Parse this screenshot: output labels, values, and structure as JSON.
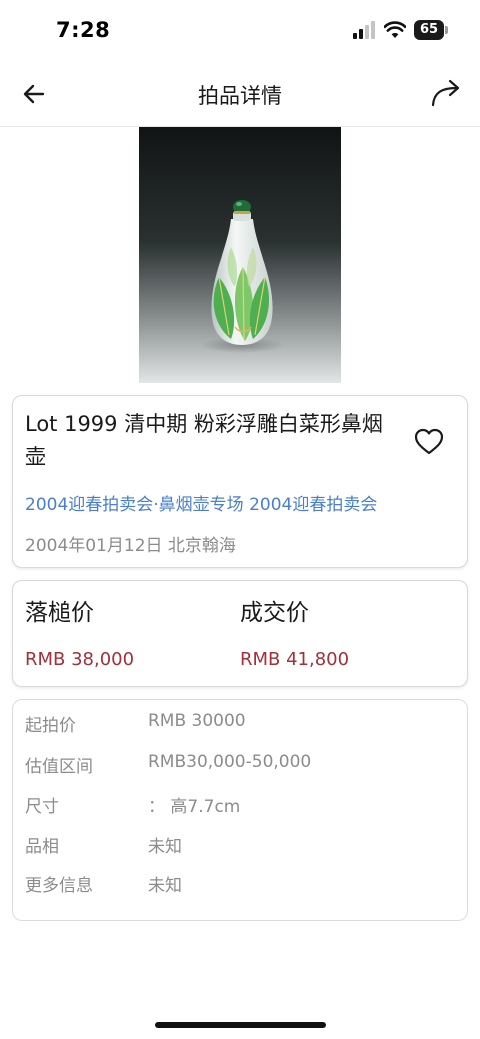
{
  "status_bar": {
    "time": "7:28",
    "battery": "65"
  },
  "nav": {
    "title": "拍品详情"
  },
  "lot": {
    "title": "Lot 1999 清中期 粉彩浮雕白菜形鼻烟壶",
    "sale_name": "2004迎春拍卖会·鼻烟壶专场 2004迎春拍卖会",
    "sale_meta": "2004年01月12日 北京翰海"
  },
  "prices": {
    "hammer_label": "落槌价",
    "hammer_value": "RMB 38,000",
    "final_label": "成交价",
    "final_value": "RMB 41,800"
  },
  "info": [
    {
      "key": "起拍价",
      "value": "RMB 30000"
    },
    {
      "key": "估值区间",
      "value": "RMB30,000-50,000"
    },
    {
      "key": "尺寸",
      "value": "：  高7.7cm"
    },
    {
      "key": "品相",
      "value": "未知"
    },
    {
      "key": "更多信息",
      "value": "未知"
    }
  ],
  "icons": {
    "back": "arrow-left-icon",
    "share": "share-arrow-icon",
    "favorite": "heart-outline-icon",
    "signal": "cellular-signal-icon",
    "wifi": "wifi-icon",
    "battery": "battery-icon"
  },
  "colors": {
    "link_blue": "#4a7fc9",
    "price_red": "#a3303a",
    "muted_gray": "#8c8c8c"
  }
}
